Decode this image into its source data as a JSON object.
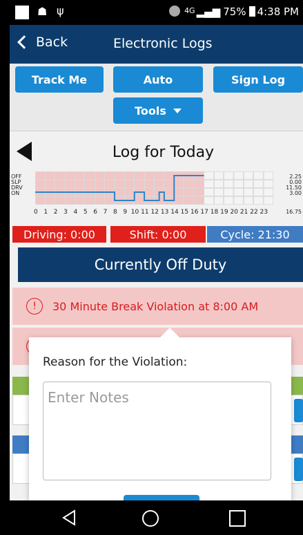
{
  "status_bar": {
    "network": "4G",
    "battery": "75%",
    "time": "4:38 PM"
  },
  "nav": {
    "back_label": "Back",
    "title": "Electronic Logs"
  },
  "actions": {
    "track_me": "Track Me",
    "auto": "Auto",
    "sign_log": "Sign Log",
    "tools": "Tools"
  },
  "log": {
    "title": "Log for Today",
    "row_labels": [
      "OFF",
      "SLP",
      "DRV",
      "ON"
    ],
    "row_totals": [
      "2.25",
      "0.00",
      "11.50",
      "3.00"
    ],
    "grand_total": "16.75",
    "hours": [
      "0",
      "1",
      "2",
      "3",
      "4",
      "5",
      "6",
      "7",
      "8",
      "9",
      "10",
      "11",
      "12",
      "13",
      "14",
      "15",
      "16",
      "17",
      "18",
      "19",
      "20",
      "21",
      "22",
      "23"
    ],
    "violation_hours": [
      0,
      1,
      2,
      3,
      4,
      5,
      6,
      7,
      8,
      9,
      10,
      11,
      12,
      13,
      14,
      15,
      16
    ]
  },
  "clocks": {
    "driving": "Driving: 0:00",
    "shift": "Shift: 0:00",
    "cycle": "Cycle: 21:30",
    "drive_color": "#e0201a",
    "cycle_color": "#3f7cc4"
  },
  "duty_status": "Currently Off Duty",
  "violations": [
    {
      "text": "30 Minute Break Violation at 8:00 AM"
    }
  ],
  "popover": {
    "label": "Reason for the Violation:",
    "placeholder": "Enter Notes"
  },
  "icons": {
    "warning": "warning-icon",
    "back": "chevron-left-icon",
    "previous": "triangle-left-icon",
    "tools": "caret-down-icon"
  },
  "colors": {
    "navbar": "#0d3c6c",
    "button": "#1a8ad4",
    "violation_bg": "#f4c7c7",
    "violation_text": "#d81b1b",
    "graph_line": "#2a86c8"
  }
}
